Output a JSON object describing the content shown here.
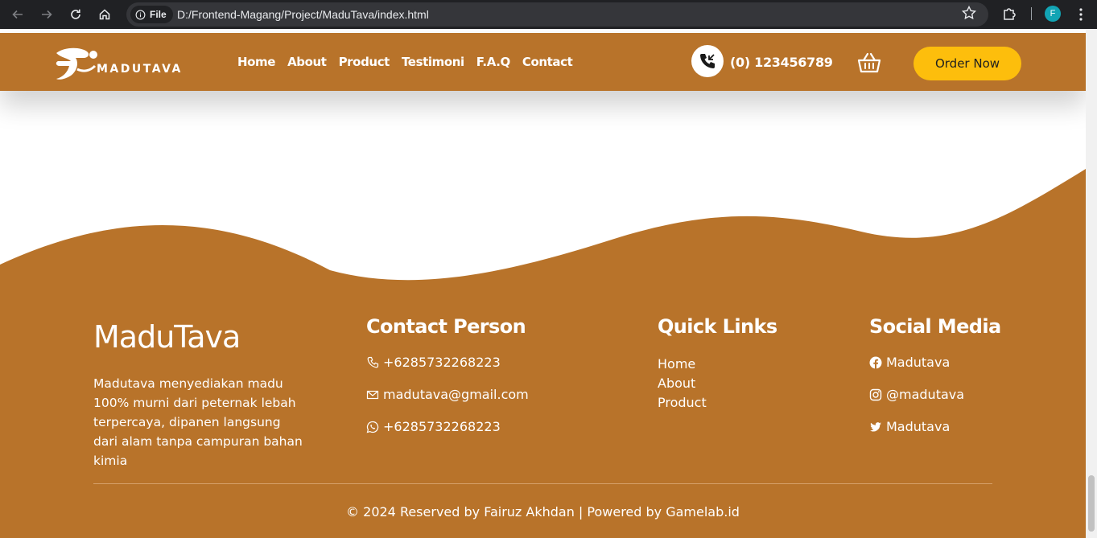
{
  "browser": {
    "chip_label": "File",
    "url": "D:/Frontend-Magang/Project/MaduTava/index.html",
    "profile_initial": "F"
  },
  "navbar": {
    "brand": "MADUTAVA",
    "links": [
      "Home",
      "About",
      "Product",
      "Testimoni",
      "F.A.Q",
      "Contact"
    ],
    "phone": "(0) 123456789",
    "order_label": "Order Now"
  },
  "footer": {
    "brand": "MaduTava",
    "description": "Madutava menyediakan madu 100% murni dari peternak lebah terpercaya, dipanen langsung dari alam tanpa campuran bahan kimia",
    "contact": {
      "title": "Contact Person",
      "phone": "+6285732268223",
      "email": "madutava@gmail.com",
      "whatsapp": "+6285732268223"
    },
    "quick_links": {
      "title": "Quick Links",
      "items": [
        "Home",
        "About",
        "Product"
      ]
    },
    "social": {
      "title": "Social Media",
      "facebook": "Madutava",
      "instagram": "@madutava",
      "twitter": "Madutava"
    },
    "copyright": "© 2024 Reserved by Fairuz Akhdan | Powered by Gamelab.id"
  },
  "colors": {
    "primary": "#b8732a",
    "accent": "#fdbe0c"
  }
}
